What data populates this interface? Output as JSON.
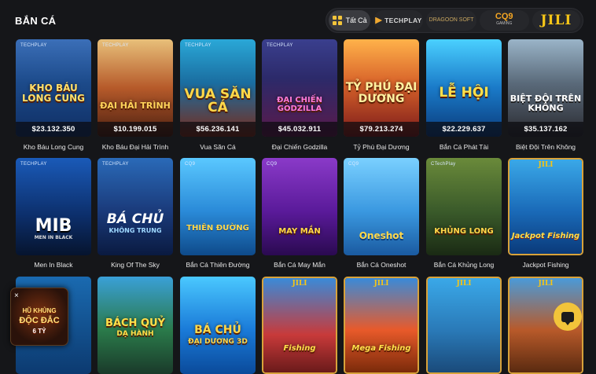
{
  "page": {
    "title": "BẮN CÁ"
  },
  "providers": [
    {
      "label": "Tất Cả",
      "icon": "grid-icon",
      "active": true
    },
    {
      "label": "TECHPLAY",
      "icon": "techplay-logo"
    },
    {
      "label": "DRAGOON SOFT",
      "icon": "dragoon-logo"
    },
    {
      "label": "CQ9",
      "sub": "GAMING",
      "icon": "cq9-logo"
    },
    {
      "label": "JILI",
      "icon": "jili-logo"
    }
  ],
  "games": [
    {
      "name": "Kho Báu Long Cung",
      "logo": "KHO BÁU LONG CUNG",
      "price": "$23.132.350",
      "badge": "TECHPLAY"
    },
    {
      "name": "Kho Báu Đại Hải Trình",
      "logo": "ĐẠI HẢI TRÌNH",
      "price": "$10.199.015",
      "badge": "TECHPLAY"
    },
    {
      "name": "Vua Săn Cá",
      "logo": "VUA SĂN CÁ",
      "price": "$56.236.141",
      "badge": "TECHPLAY"
    },
    {
      "name": "Đại Chiến Godzilla",
      "logo": "ĐẠI CHIẾN GODZILLA",
      "price": "$45.032.911",
      "badge": "TECHPLAY"
    },
    {
      "name": "Tỷ Phú Đại Dương",
      "logo": "TỶ PHÚ ĐẠI DƯƠNG",
      "price": "$79.213.274",
      "badge": ""
    },
    {
      "name": "Bắn Cá Phát Tài",
      "logo": "LỄ HỘI",
      "price": "$22.229.637",
      "badge": ""
    },
    {
      "name": "Biệt Đội Trên Không",
      "logo": "BIỆT ĐỘI TRÊN KHÔNG",
      "price": "$35.137.162",
      "badge": ""
    },
    {
      "name": "Men In Black",
      "logo": "MIB",
      "sub": "MEN IN BLACK",
      "badge": "TECHPLAY"
    },
    {
      "name": "King Of The Sky",
      "logo": "BÁ CHỦ",
      "sub": "KHÔNG TRUNG",
      "badge": "TECHPLAY"
    },
    {
      "name": "Bắn Cá Thiên Đường",
      "logo": "THIÊN ĐƯỜNG",
      "badge": "CQ9"
    },
    {
      "name": "Bắn Cá May Mắn",
      "logo": "MAY MẮN",
      "badge": "CQ9"
    },
    {
      "name": "Bắn Cá Oneshot",
      "logo": "Oneshot",
      "badge": "CQ9"
    },
    {
      "name": "Bắn Cá Khủng Long",
      "logo": "KHỦNG LONG",
      "badge": "CTechPlay"
    },
    {
      "name": "Jackpot Fishing",
      "logo": "Jackpot Fishing",
      "badge": "JILI"
    },
    {
      "name": "",
      "logo": "",
      "badge": ""
    },
    {
      "name": "",
      "logo": "BÁCH QUỶ",
      "sub": "DẠ HÀNH",
      "badge": ""
    },
    {
      "name": "",
      "logo": "BÁ CHỦ",
      "sub": "ĐẠI DƯƠNG 3D",
      "badge": ""
    },
    {
      "name": "",
      "logo": "Fishing",
      "badge": "JILI"
    },
    {
      "name": "",
      "logo": "Mega Fishing",
      "badge": "JILI"
    },
    {
      "name": "",
      "logo": "",
      "badge": "JILI"
    },
    {
      "name": "",
      "logo": "",
      "badge": "JILI"
    }
  ],
  "promo": {
    "line1": "HŨ KHỦNG",
    "line2": "ĐỘC ĐẮC",
    "line3": "6 TỶ",
    "close": "×"
  },
  "chat": {
    "icon": "chat-icon"
  }
}
